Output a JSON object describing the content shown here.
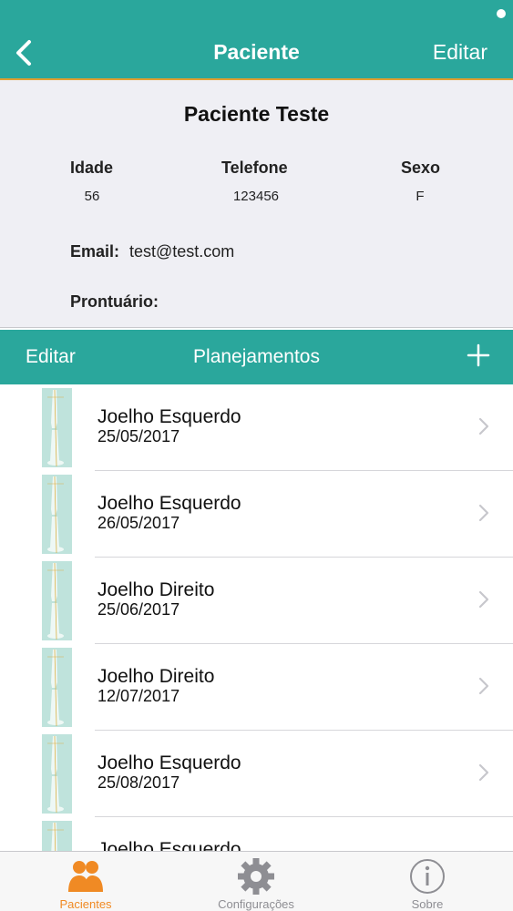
{
  "colors": {
    "accent": "#2aa79c",
    "active_tab": "#f08a24",
    "inactive_tab": "#8e8e93"
  },
  "nav": {
    "back_icon": "chevron-left-icon",
    "title": "Paciente",
    "edit_label": "Editar"
  },
  "patient": {
    "name": "Paciente Teste",
    "fields": [
      {
        "label": "Idade",
        "value": "56"
      },
      {
        "label": "Telefone",
        "value": "123456"
      },
      {
        "label": "Sexo",
        "value": "F"
      }
    ],
    "email_label": "Email:",
    "email_value": "test@test.com",
    "record_label": "Prontuário:",
    "record_value": ""
  },
  "plans_section": {
    "edit_label": "Editar",
    "title": "Planejamentos",
    "add_icon": "plus-icon"
  },
  "plans": [
    {
      "title": "Joelho Esquerdo",
      "date": "25/05/2017"
    },
    {
      "title": "Joelho Esquerdo",
      "date": "26/05/2017"
    },
    {
      "title": "Joelho Direito",
      "date": "25/06/2017"
    },
    {
      "title": "Joelho Direito",
      "date": "12/07/2017"
    },
    {
      "title": "Joelho Esquerdo",
      "date": "25/08/2017"
    },
    {
      "title": "Joelho Esquerdo",
      "date": ""
    }
  ],
  "tabs": [
    {
      "label": "Pacientes",
      "icon": "people-icon",
      "active": true
    },
    {
      "label": "Configurações",
      "icon": "gear-icon",
      "active": false
    },
    {
      "label": "Sobre",
      "icon": "info-icon",
      "active": false
    }
  ]
}
